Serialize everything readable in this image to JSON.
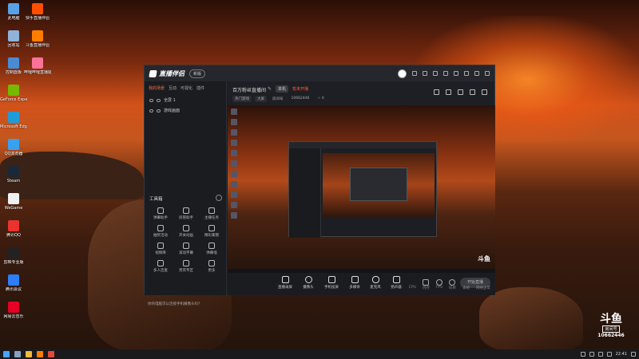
{
  "desktop": {
    "icons_left": [
      {
        "label": "此电脑",
        "icon": "computer-icon",
        "color": "#5aa0e6"
      },
      {
        "label": "回收站",
        "icon": "recycle-bin-icon",
        "color": "#8fb3d9"
      },
      {
        "label": "控制面板",
        "icon": "control-panel-icon",
        "color": "#4a8bd6"
      },
      {
        "label": "GeForce Experience",
        "icon": "geforce-icon",
        "color": "#76b900"
      },
      {
        "label": "Microsoft Edge",
        "icon": "edge-icon",
        "color": "#1f9cd8"
      },
      {
        "label": "QQ浏览器",
        "icon": "qq-browser-icon",
        "color": "#3aa0f0"
      },
      {
        "label": "Steam",
        "icon": "steam-icon",
        "color": "#1b2838"
      },
      {
        "label": "WeGame",
        "icon": "wegame-icon",
        "color": "#f0f0f0"
      },
      {
        "label": "腾讯QQ",
        "icon": "qq-icon",
        "color": "#e8332e"
      },
      {
        "label": "剪映专业版",
        "icon": "jianying-icon",
        "color": "#222222"
      },
      {
        "label": "腾讯会议",
        "icon": "tencent-meeting-icon",
        "color": "#2f7df6"
      },
      {
        "label": "网易云音乐",
        "icon": "netease-music-icon",
        "color": "#e60026"
      }
    ],
    "icons_right": [
      {
        "label": "快手直播伴侣",
        "icon": "kuaishou-icon",
        "color": "#ff5000"
      },
      {
        "label": "斗鱼直播伴侣",
        "icon": "douyu-icon",
        "color": "#ff7e00"
      },
      {
        "label": "哔哩哔哩直播姬",
        "icon": "bilibili-icon",
        "color": "#fb7299"
      }
    ]
  },
  "app": {
    "logo_text": "直播伴侣",
    "version_badge": "新版",
    "left_tabs": [
      "我的场景",
      "互动",
      "可视化",
      "插件"
    ],
    "scenes": [
      "全屏 1",
      "游戏画面"
    ],
    "toolbox_title": "工具箱",
    "tools": [
      "弹幕助手",
      "房管助手",
      "主播任务",
      "抽奖活动",
      "开关动画",
      "精彩集锦",
      "视频库",
      "滚动字幕",
      "弹幕墙",
      "多人连麦",
      "贵宾专区",
      "更多"
    ],
    "notice": "你的电脑可以连接手机摄像头吗？",
    "stream_title": "百万粉丝直播间",
    "stream_title_edit": "✎",
    "tag_gray": "单机",
    "tag_red": "暂未开播",
    "info": [
      "热门游戏",
      "大屏",
      "房间号",
      "10662446",
      "☆ 0"
    ],
    "controls": [
      "直播录屏",
      "摄像头",
      "手机投屏",
      "多媒体",
      "麦克风",
      "扬声器"
    ],
    "start_button": "开始直播",
    "status": [
      "CPU",
      "内存",
      "FPS",
      "码率",
      "丢帧",
      "网络正常"
    ]
  },
  "watermark": {
    "logo": "斗鱼",
    "room_label": "房间号",
    "room_number": "10662446"
  },
  "taskbar": {
    "time": "22:41",
    "apps": [
      {
        "icon": "start-icon",
        "color": "#4aa3ff"
      },
      {
        "icon": "steam-task-icon",
        "color": "#8aa0c0"
      },
      {
        "icon": "folder-icon",
        "color": "#f2b93b"
      },
      {
        "icon": "douyu-task-icon",
        "color": "#ff7e00"
      },
      {
        "icon": "chrome-icon",
        "color": "#e24a3a"
      }
    ]
  }
}
